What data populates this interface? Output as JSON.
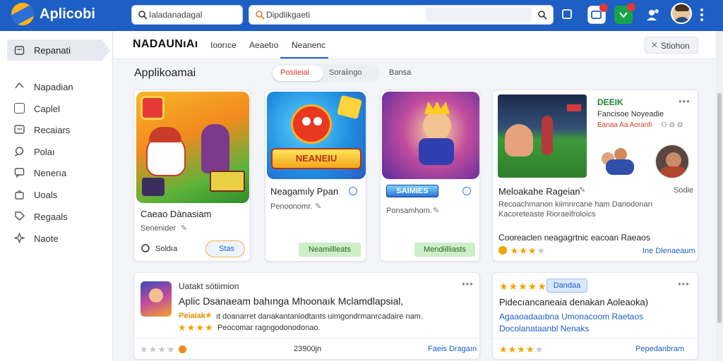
{
  "app": {
    "title": "Aplicobi"
  },
  "topbar": {
    "search_left": "Ialadanadagal",
    "search_main": "Dipdlikgaeti"
  },
  "sidebar": {
    "active": "Repanati",
    "items": [
      {
        "label": "Napadian",
        "icon": "compass-icon"
      },
      {
        "label": "Caplel",
        "icon": "square-icon"
      },
      {
        "label": "Recaiars",
        "icon": "list-icon"
      },
      {
        "label": "Polaı",
        "icon": "chat-icon"
      },
      {
        "label": "Nenerıa",
        "icon": "message-icon"
      },
      {
        "label": "Uoals",
        "icon": "bag-icon"
      },
      {
        "label": "Regaals",
        "icon": "tag-icon"
      },
      {
        "label": "Naote",
        "icon": "puzzle-icon"
      }
    ]
  },
  "header": {
    "brand": "NADAUNıAı",
    "tabs": [
      "Ioorıce",
      "Aeaetıo",
      "Neanenc"
    ],
    "button": "Stiohon"
  },
  "section": {
    "title": "Applikoamai",
    "pill_active": "Posiieiai",
    "pill_other": "Soraiingo",
    "link": "Bansa"
  },
  "cards": [
    {
      "title": "Caeao Dànasiam",
      "sub": "Senenider",
      "action1": "Soldıa",
      "action2": "Stas"
    },
    {
      "title": "Neagamıly Ppan",
      "sub": "Penoonomr.",
      "button": "Neamillleats",
      "thumb_text": "NEANEIU"
    },
    {
      "title": "",
      "sub": "Ponsamhom.",
      "button": "Mendiilliasts",
      "thumb_text": "SAIMIES"
    },
    {
      "corner_title": "DEEIK",
      "corner_sub": "Fancisoe Noyeadie",
      "corner_red": "Eanaa Aa Aoranfi",
      "title": "Meloakahe Rageian",
      "right_label": "Sodie",
      "desc1": "Recoachmanon kiimnrcane ham Danodonarı",
      "desc2": "Kacoreteaste Rioraeifroloics",
      "line3": "Cooreaclen neagagrtnic eacoan Raeaos",
      "link": "Ine Dlenaeaum"
    }
  ],
  "bottom_cards": [
    {
      "head": "Uatakt sötiimion",
      "title": "Aplic Dsanaeam bahınga Mhoonaık Mclamdlapsial,",
      "line1a": "Peiaiak",
      "line1b": "ıt doanarret danakantaniodtants uimgondrmanrcadaire nam.",
      "line2": "Peocomar ragngodonodonao.",
      "middle": "23900jn",
      "link": "Faeis Dragaın"
    },
    {
      "badge": "Dandaa",
      "title": "Pidecıancaneaia denakan Aoleaoka)",
      "line1": "Agaaoadaaıbna Umonacoom Raetaos",
      "line2": "Docolanataanbl Nenaks",
      "link": "Pepedanbram"
    }
  ],
  "colors": {
    "primary": "#1d5fc4",
    "accent_green": "#1b8a2e",
    "star": "#f2a300"
  }
}
